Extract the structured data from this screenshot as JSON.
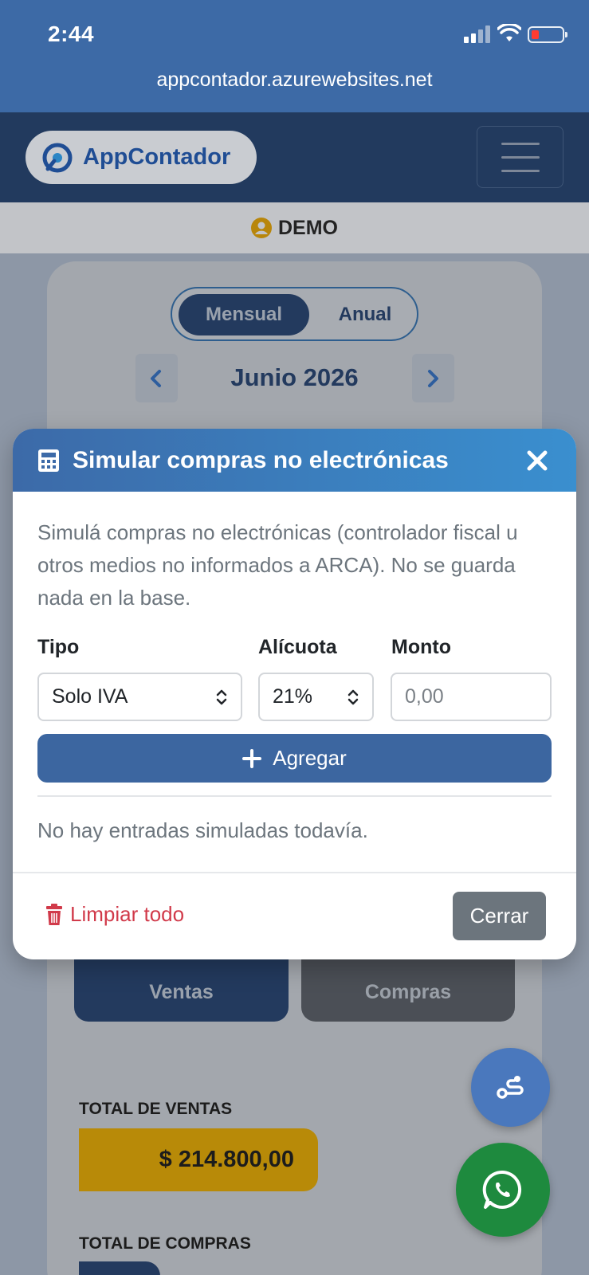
{
  "status": {
    "time": "2:44",
    "url": "appcontador.azurewebsites.net"
  },
  "navbar": {
    "brand": "AppContador"
  },
  "user": {
    "name": "DEMO"
  },
  "period": {
    "tabs": [
      "Mensual",
      "Anual"
    ],
    "active": "Mensual",
    "month": "Junio 2026"
  },
  "tiles": {
    "ventas": "Ventas",
    "compras": "Compras"
  },
  "totals": {
    "ventas_label": "TOTAL DE VENTAS",
    "ventas_value": "$ 214.800,00",
    "compras_label": "TOTAL DE COMPRAS"
  },
  "modal": {
    "title": "Simular compras no electrónicas",
    "description": "Simulá compras no electrónicas (controlador fiscal u otros medios no informados a ARCA). No se guarda nada en la base.",
    "labels": {
      "tipo": "Tipo",
      "alicuota": "Alícuota",
      "monto": "Monto"
    },
    "tipo_value": "Solo IVA",
    "alicuota_value": "21%",
    "monto_placeholder": "0,00",
    "add_label": "Agregar",
    "empty_text": "No hay entradas simuladas todavía.",
    "clear_label": "Limpiar todo",
    "close_label": "Cerrar"
  },
  "colors": {
    "primary": "#3c66a0",
    "header_gradient_start": "#3c6aa8",
    "header_gradient_end": "#3a8fcf",
    "danger": "#d13a4a",
    "secondary": "#6c757d",
    "whatsapp": "#1e8a3e"
  }
}
